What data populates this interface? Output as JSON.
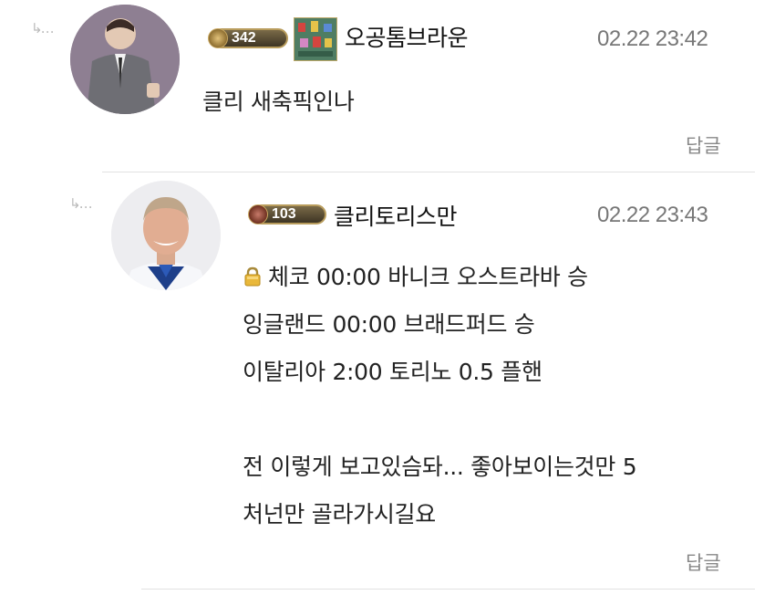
{
  "comments": [
    {
      "level": "342",
      "nickname": "오공톰브라운",
      "time": "02.22 23:42",
      "lines": [
        "클리 새축픽인나"
      ],
      "reply": "답글"
    },
    {
      "level": "103",
      "nickname": "클리토리스만",
      "time": "02.22 23:43",
      "lines": [
        "체코 00:00 바니크 오스트라바 승",
        "잉글랜드 00:00 브래드퍼드 승",
        "이탈리아 2:00 토리노 0.5 플핸",
        "",
        "전 이렇게 보고있슴돠... 좋아보이는것만 5",
        "처넌만 골라가시길요"
      ],
      "reply": "답글"
    }
  ],
  "icons": {
    "reply_arrow": "reply-indent-arrow-icon",
    "lock": "lock-icon",
    "level_badge": "level-badge-icon",
    "item_icon": "item-thumbnail-icon"
  },
  "colors": {
    "badge_gold": "#b89c5c",
    "time_gray": "#777777",
    "divider": "#e2e2e2"
  }
}
